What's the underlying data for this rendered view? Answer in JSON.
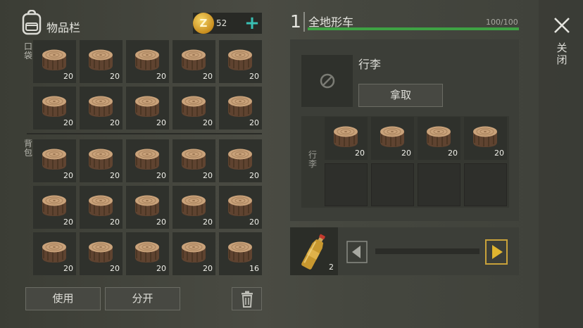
{
  "inventory": {
    "title": "物品栏",
    "coin_symbol": "Z",
    "coins": "52",
    "plus": "+",
    "pocket_label": "口袋",
    "backpack_label": "背包",
    "pocket_slots": [
      {
        "item": "log",
        "qty": "20"
      },
      {
        "item": "log",
        "qty": "20"
      },
      {
        "item": "log",
        "qty": "20"
      },
      {
        "item": "log",
        "qty": "20"
      },
      {
        "item": "log",
        "qty": "20"
      },
      {
        "item": "log",
        "qty": "20"
      },
      {
        "item": "log",
        "qty": "20"
      },
      {
        "item": "log",
        "qty": "20"
      },
      {
        "item": "log",
        "qty": "20"
      },
      {
        "item": "log",
        "qty": "20"
      }
    ],
    "backpack_slots": [
      {
        "item": "log",
        "qty": "20"
      },
      {
        "item": "log",
        "qty": "20"
      },
      {
        "item": "log",
        "qty": "20"
      },
      {
        "item": "log",
        "qty": "20"
      },
      {
        "item": "log",
        "qty": "20"
      },
      {
        "item": "log",
        "qty": "20"
      },
      {
        "item": "log",
        "qty": "20"
      },
      {
        "item": "log",
        "qty": "20"
      },
      {
        "item": "log",
        "qty": "20"
      },
      {
        "item": "log",
        "qty": "20"
      },
      {
        "item": "log",
        "qty": "20"
      },
      {
        "item": "log",
        "qty": "20"
      },
      {
        "item": "log",
        "qty": "20"
      },
      {
        "item": "log",
        "qty": "20"
      },
      {
        "item": "log",
        "qty": "16"
      }
    ],
    "use_label": "使用",
    "split_label": "分开",
    "trash_icon": "trash-icon"
  },
  "vehicle": {
    "number": "1",
    "name": "全地形车",
    "durability": "100/100",
    "durability_fraction": 1.0,
    "durability_color": "#3ea244",
    "trunk_title": "行李",
    "take_label": "拿取",
    "trunk_side_label": "行李",
    "trunk_slots": [
      {
        "item": "log",
        "qty": "20"
      },
      {
        "item": "log",
        "qty": "20"
      },
      {
        "item": "log",
        "qty": "20"
      },
      {
        "item": "log",
        "qty": "20"
      },
      {
        "item": "",
        "qty": ""
      },
      {
        "item": "",
        "qty": ""
      },
      {
        "item": "",
        "qty": ""
      },
      {
        "item": "",
        "qty": ""
      }
    ],
    "fuel": {
      "item": "gas-bottle",
      "qty": "2"
    }
  },
  "close_label": "关闭",
  "accent_color": "#39c0b4"
}
